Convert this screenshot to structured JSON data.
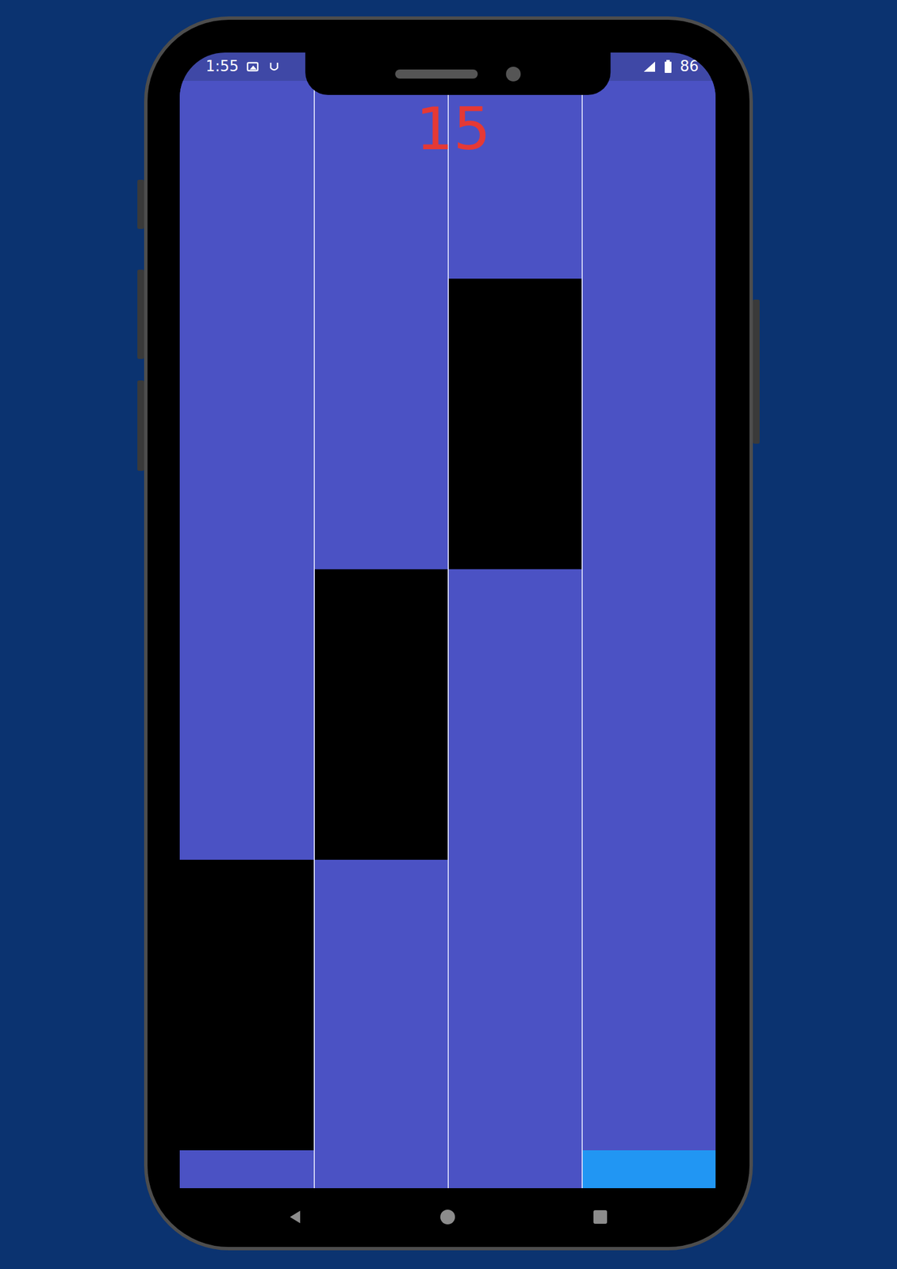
{
  "status_bar": {
    "time": "1:55",
    "battery": "86"
  },
  "score": "15",
  "rows": [
    {
      "cells": [
        {
          "kind": "empty"
        },
        {
          "kind": "empty"
        },
        {
          "kind": "empty"
        },
        {
          "kind": "empty"
        }
      ]
    },
    {
      "cells": [
        {
          "kind": "empty"
        },
        {
          "kind": "empty"
        },
        {
          "kind": "tile"
        },
        {
          "kind": "empty"
        }
      ]
    },
    {
      "cells": [
        {
          "kind": "empty"
        },
        {
          "kind": "tile"
        },
        {
          "kind": "empty"
        },
        {
          "kind": "empty"
        }
      ]
    },
    {
      "cells": [
        {
          "kind": "tile"
        },
        {
          "kind": "empty"
        },
        {
          "kind": "empty"
        },
        {
          "kind": "empty"
        }
      ]
    },
    {
      "cells": [
        {
          "kind": "empty"
        },
        {
          "kind": "empty"
        },
        {
          "kind": "empty"
        },
        {
          "kind": "tapped"
        }
      ]
    }
  ]
}
